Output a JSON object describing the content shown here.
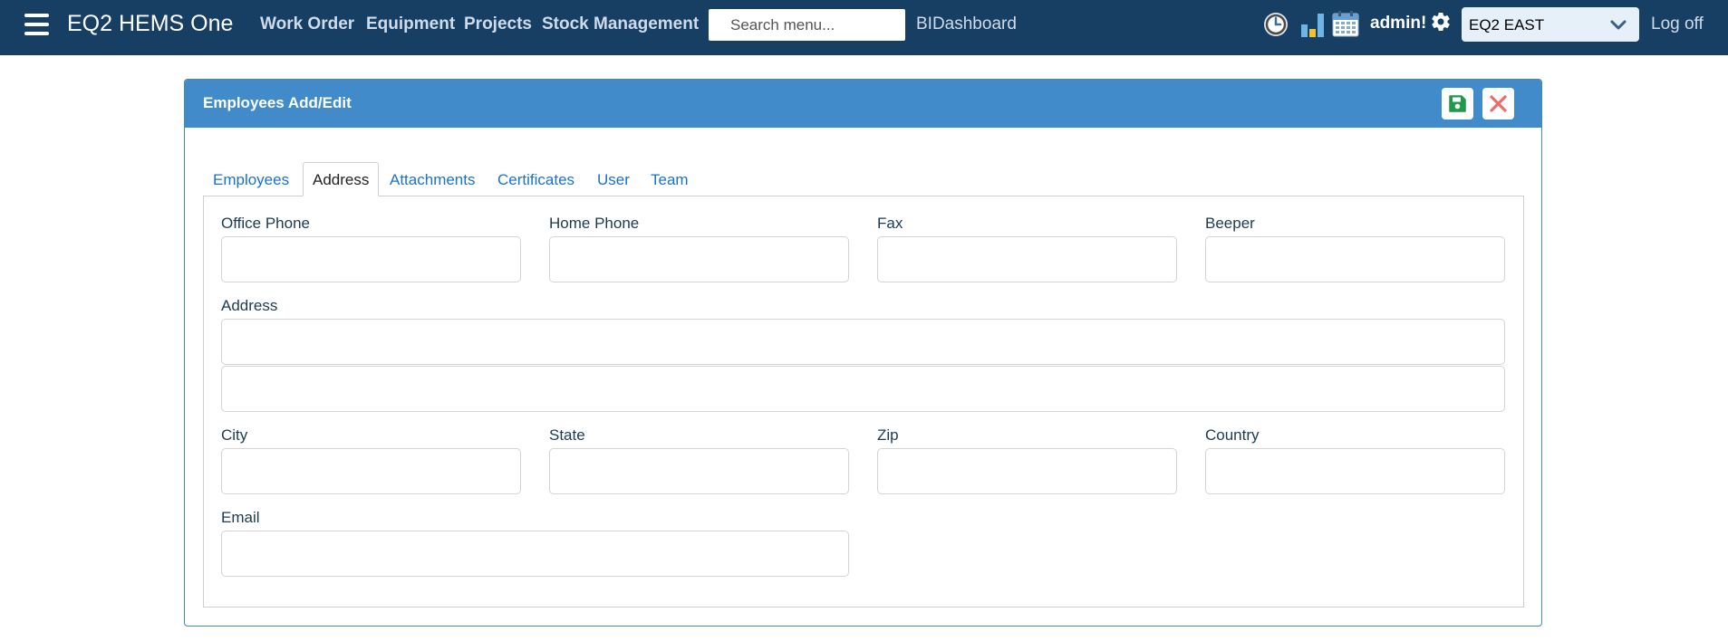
{
  "navbar": {
    "brand": "EQ2 HEMS One",
    "links": [
      "Work Order",
      "Equipment",
      "Projects",
      "Stock Management"
    ],
    "search_placeholder": "Search menu...",
    "bi_dashboard": "BIDashboard",
    "icons": [
      "clock-icon",
      "bar-chart-icon",
      "calendar-icon",
      "gear-icon"
    ],
    "user": "admin!",
    "region": "EQ2 EAST",
    "logoff": "Log off"
  },
  "panel": {
    "title": "Employees Add/Edit",
    "save_icon": "save-icon",
    "close_icon": "close-icon",
    "accent": "#418bca"
  },
  "tabs": [
    "Employees",
    "Address",
    "Attachments",
    "Certificates",
    "User",
    "Team"
  ],
  "active_tab": "Address",
  "form": {
    "office_phone": {
      "label": "Office Phone",
      "value": ""
    },
    "home_phone": {
      "label": "Home Phone",
      "value": ""
    },
    "fax": {
      "label": "Fax",
      "value": ""
    },
    "beeper": {
      "label": "Beeper",
      "value": ""
    },
    "address": {
      "label": "Address",
      "line1": "",
      "line2": ""
    },
    "city": {
      "label": "City",
      "value": ""
    },
    "state": {
      "label": "State",
      "value": ""
    },
    "zip": {
      "label": "Zip",
      "value": ""
    },
    "country": {
      "label": "Country",
      "value": ""
    },
    "email": {
      "label": "Email",
      "value": ""
    }
  }
}
